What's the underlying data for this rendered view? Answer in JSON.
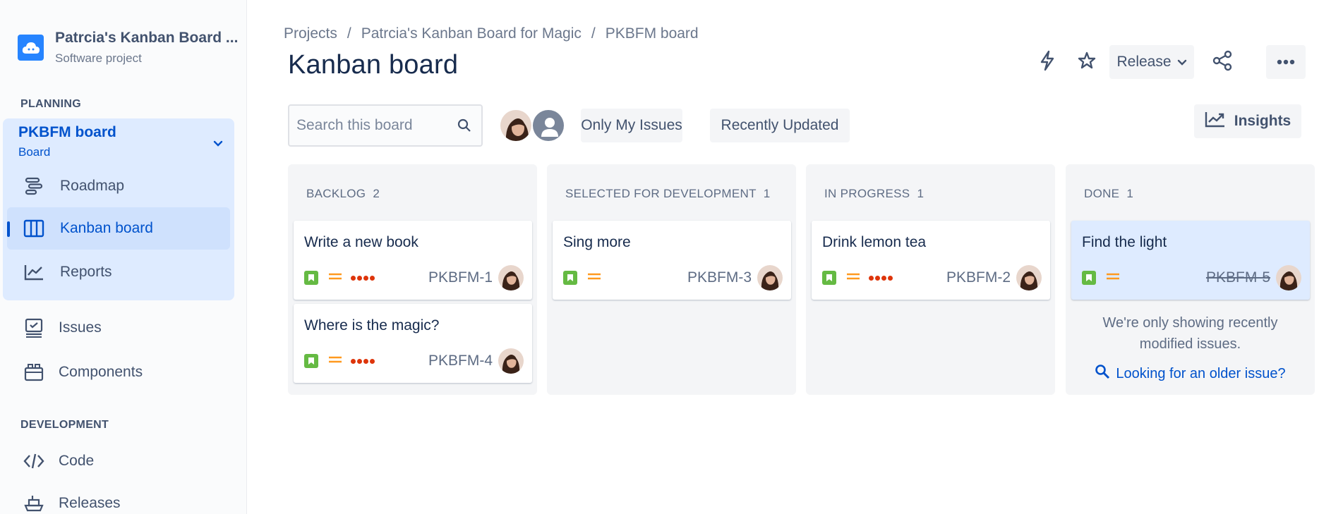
{
  "sidebar": {
    "project_name": "Patrcia's Kanban Board ...",
    "project_type": "Software project",
    "planning_title": "PLANNING",
    "board_name": "PKBFM board",
    "board_sub": "Board",
    "items": [
      {
        "label": "Roadmap",
        "icon": "roadmap-icon"
      },
      {
        "label": "Kanban board",
        "icon": "kanban-board-icon",
        "active": true
      },
      {
        "label": "Reports",
        "icon": "reports-icon"
      },
      {
        "label": "Issues",
        "icon": "issues-icon"
      },
      {
        "label": "Components",
        "icon": "components-icon"
      }
    ],
    "development_title": "DEVELOPMENT",
    "dev_items": [
      {
        "label": "Code",
        "icon": "code-icon"
      },
      {
        "label": "Releases",
        "icon": "releases-icon"
      }
    ]
  },
  "breadcrumb": [
    "Projects",
    "Patrcia's Kanban Board for Magic",
    "PKBFM board"
  ],
  "page_title": "Kanban board",
  "toolbar": {
    "release_label": "Release",
    "search_placeholder": "Search this board",
    "filter_my_issues": "Only My Issues",
    "filter_recent": "Recently Updated",
    "insights_label": "Insights"
  },
  "columns": [
    {
      "title": "BACKLOG",
      "count": "2",
      "cards": [
        {
          "title": "Write a new book",
          "key": "PKBFM-1",
          "dots": true
        },
        {
          "title": "Where is the magic?",
          "key": "PKBFM-4",
          "dots": true
        }
      ]
    },
    {
      "title": "SELECTED FOR DEVELOPMENT",
      "count": "1",
      "cards": [
        {
          "title": "Sing more",
          "key": "PKBFM-3",
          "dots": false
        }
      ]
    },
    {
      "title": "IN PROGRESS",
      "count": "1",
      "cards": [
        {
          "title": "Drink lemon tea",
          "key": "PKBFM-2",
          "dots": true
        }
      ]
    },
    {
      "title": "DONE",
      "count": "1",
      "cards": [
        {
          "title": "Find the light",
          "key": "PKBFM-5",
          "dots": false,
          "done": true
        }
      ],
      "note_line1": "We're only showing recently",
      "note_line2": "modified issues.",
      "older_link": "Looking for an older issue?"
    }
  ],
  "colors": {
    "accent": "#0052cc",
    "story": "#65ba43",
    "priority": "#ff991f",
    "estimate": "#de350b"
  }
}
